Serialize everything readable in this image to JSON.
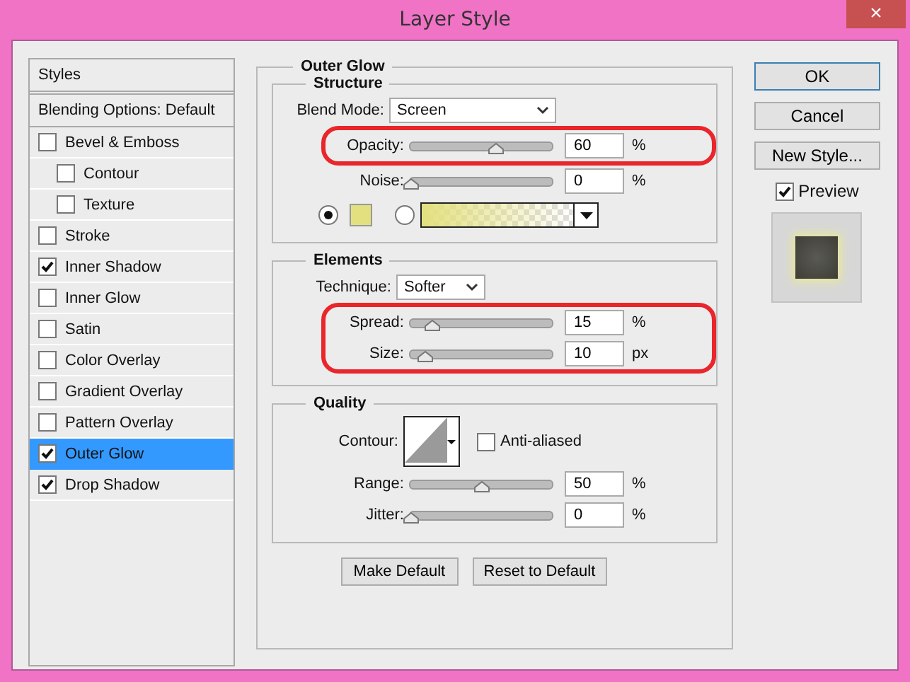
{
  "window": {
    "title": "Layer Style",
    "close": "×"
  },
  "styles_panel": {
    "header": "Styles",
    "blending": "Blending Options: Default",
    "items": [
      {
        "label": "Bevel & Emboss",
        "checked": false,
        "selected": false,
        "children": [
          {
            "label": "Contour",
            "checked": false,
            "selected": false
          },
          {
            "label": "Texture",
            "checked": false,
            "selected": false
          }
        ]
      },
      {
        "label": "Stroke",
        "checked": false,
        "selected": false
      },
      {
        "label": "Inner Shadow",
        "checked": true,
        "selected": false
      },
      {
        "label": "Inner Glow",
        "checked": false,
        "selected": false
      },
      {
        "label": "Satin",
        "checked": false,
        "selected": false
      },
      {
        "label": "Color Overlay",
        "checked": false,
        "selected": false
      },
      {
        "label": "Gradient Overlay",
        "checked": false,
        "selected": false
      },
      {
        "label": "Pattern Overlay",
        "checked": false,
        "selected": false
      },
      {
        "label": "Outer Glow",
        "checked": true,
        "selected": true
      },
      {
        "label": "Drop Shadow",
        "checked": true,
        "selected": false
      }
    ]
  },
  "outer_glow": {
    "title": "Outer Glow",
    "structure": {
      "title": "Structure",
      "blend_mode": {
        "label": "Blend Mode:",
        "value": "Screen"
      },
      "sliders": [
        {
          "label": "Opacity:",
          "level": 0.6,
          "value": "60",
          "unit": "%",
          "highlighted": true
        },
        {
          "label": "Noise:",
          "level": 0,
          "value": "0",
          "unit": "%",
          "highlighted": false
        }
      ],
      "fill_options": [
        {
          "kind": "color",
          "selected": true,
          "color": "#e3e07f"
        },
        {
          "kind": "gradient",
          "selected": false,
          "color": "#e3e07f"
        }
      ]
    },
    "elements": {
      "title": "Elements",
      "technique": {
        "label": "Technique:",
        "value": "Softer"
      },
      "sliders": [
        {
          "label": "Spread:",
          "level": 0.15,
          "value": "15",
          "unit": "%",
          "highlighted": true
        },
        {
          "label": "Size:",
          "level": 0.1,
          "value": "10",
          "unit": "px",
          "highlighted": true
        }
      ]
    },
    "quality": {
      "title": "Quality",
      "contour": {
        "label": "Contour:"
      },
      "anti_aliased": {
        "label": "Anti-aliased",
        "checked": false
      },
      "sliders": [
        {
          "label": "Range:",
          "level": 0.5,
          "value": "50",
          "unit": "%",
          "highlighted": false
        },
        {
          "label": "Jitter:",
          "level": 0,
          "value": "0",
          "unit": "%",
          "highlighted": false
        }
      ]
    },
    "buttons": [
      "Make Default",
      "Reset to Default"
    ]
  },
  "actions": {
    "buttons": [
      {
        "label": "OK",
        "selected": true
      },
      {
        "label": "Cancel",
        "selected": false
      },
      {
        "label": "New Style...",
        "selected": false
      }
    ],
    "preview": {
      "label": "Preview",
      "checked": true
    }
  }
}
